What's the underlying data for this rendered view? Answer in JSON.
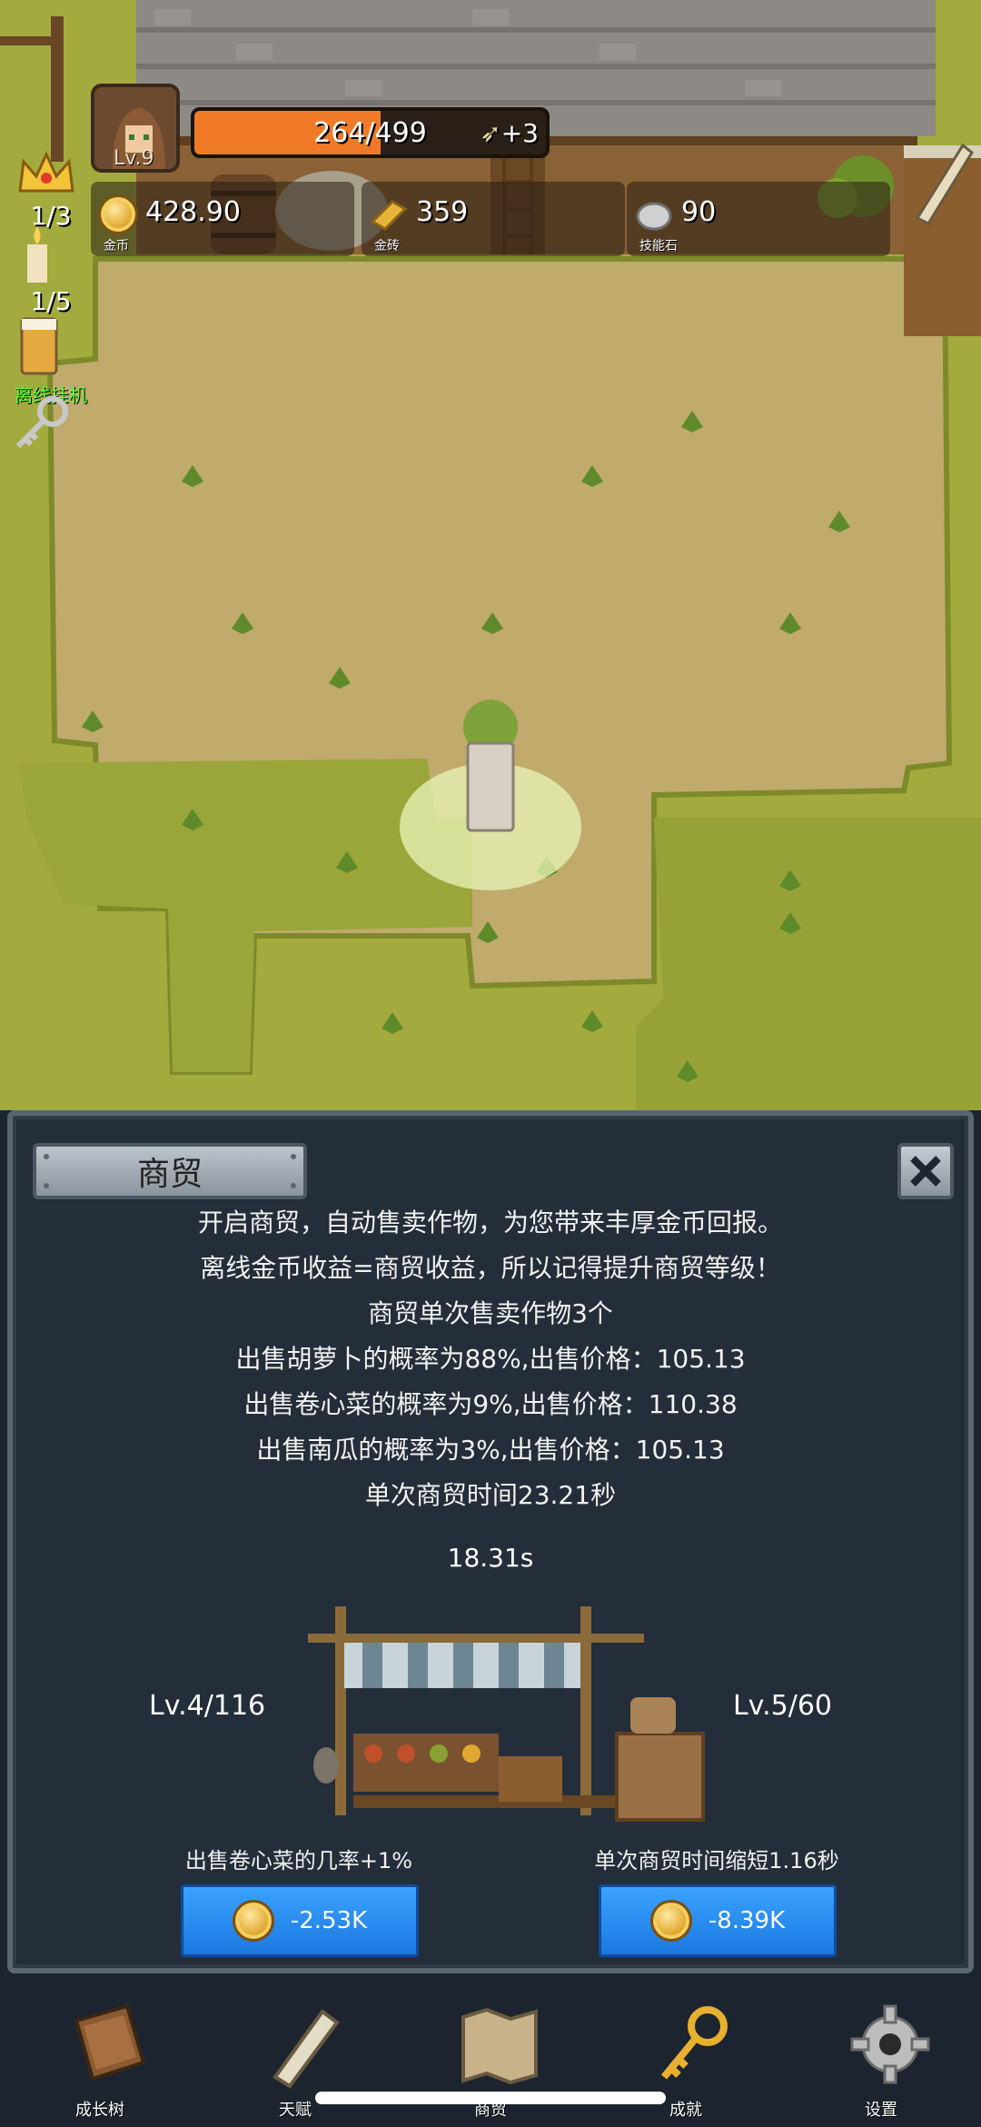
{
  "hud": {
    "level": "Lv.9",
    "xp": {
      "text": "264/499",
      "current": 264,
      "max": 499
    },
    "xp_bonus": "+3",
    "resources": [
      {
        "id": "gold",
        "value": "428.90",
        "label": "金币"
      },
      {
        "id": "gold_brick",
        "value": "359",
        "label": "金砖"
      },
      {
        "id": "skill_stone",
        "value": "90",
        "label": "技能石"
      }
    ],
    "side": {
      "candle_count": "1/3",
      "drink_count": "1/5",
      "afk_label": "离线挂机"
    }
  },
  "modal": {
    "title": "商贸",
    "description": [
      "开启商贸，自动售卖作物，为您带来丰厚金币回报。",
      "离线金币收益=商贸收益，所以记得提升商贸等级！",
      "商贸单次售卖作物3个",
      "出售胡萝卜的概率为88%,出售价格：105.13",
      "出售卷心菜的概率为9%,出售价格：110.38",
      "出售南瓜的概率为3%,出售价格：105.13",
      "单次商贸时间23.21秒"
    ],
    "timer": "18.31s",
    "left_level": "Lv.4/116",
    "right_level": "Lv.5/60",
    "upgrades": [
      {
        "label": "出售卷心菜的几率+1%",
        "cost": "-2.53K"
      },
      {
        "label": "单次商贸时间缩短1.16秒",
        "cost": "-8.39K"
      }
    ]
  },
  "nav": [
    {
      "id": "growth_tree",
      "label": "成长树"
    },
    {
      "id": "talent",
      "label": "天赋"
    },
    {
      "id": "trade",
      "label": "商贸"
    },
    {
      "id": "achievement",
      "label": "成就"
    },
    {
      "id": "settings",
      "label": "设置"
    }
  ],
  "colors": {
    "xp_fill": "#f07a28",
    "button_blue": "#2a8cf0",
    "panel_bg": "#242e3a",
    "afk_green": "#5cff3c"
  }
}
